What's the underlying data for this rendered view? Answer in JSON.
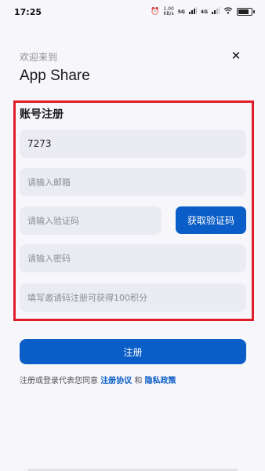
{
  "status_bar": {
    "time": "17:25",
    "speed_value": "1.00",
    "speed_unit": "KB/s",
    "net1": "5G",
    "net2": "4G"
  },
  "header": {
    "welcome": "欢迎来到",
    "app_name": "App Share",
    "close_glyph": "✕"
  },
  "form": {
    "title": "账号注册",
    "account_value": "7273",
    "email_placeholder": "请输入邮箱",
    "code_placeholder": "请输入验证码",
    "get_code_label": "获取验证码",
    "password_placeholder": "请输入密码",
    "invite_placeholder": "填写邀请码注册可获得100积分",
    "submit_label": "注册"
  },
  "agreement": {
    "prefix": "注册或登录代表您同意",
    "terms": "注册协议",
    "and": "和",
    "privacy": "隐私政策"
  },
  "colors": {
    "accent": "#0b5dc7",
    "highlight": "#e11d2a",
    "field_bg": "#ebebf3",
    "page_bg": "#f6f6fb"
  }
}
